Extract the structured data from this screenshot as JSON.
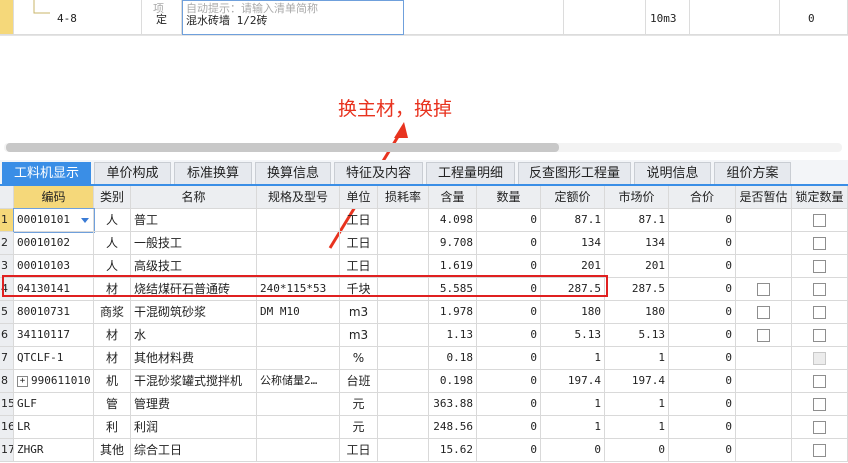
{
  "top": {
    "prev_row_hint": "自动提示：请输入清单简称",
    "prev_row_col2": "项",
    "row_code": "4-8",
    "row_type": "定",
    "row_name": "混水砖墙 1/2砖",
    "row_unit": "10m3",
    "row_value": "0"
  },
  "annotation": "换主材，换掉",
  "tabs": [
    "工料机显示",
    "单价构成",
    "标准换算",
    "换算信息",
    "特征及内容",
    "工程量明细",
    "反查图形工程量",
    "说明信息",
    "组价方案"
  ],
  "columns": [
    "编码",
    "类别",
    "名称",
    "规格及型号",
    "单位",
    "损耗率",
    "含量",
    "数量",
    "定额价",
    "市场价",
    "合价",
    "是否暂估",
    "锁定数量"
  ],
  "rows": [
    {
      "num": "1",
      "code": "00010101",
      "type": "人",
      "name": "普工",
      "spec": "",
      "unit": "工日",
      "loss": "",
      "qty": "4.098",
      "count": "0",
      "quota": "87.1",
      "market": "87.1",
      "total": "0",
      "est": "",
      "lock": "box"
    },
    {
      "num": "2",
      "code": "00010102",
      "type": "人",
      "name": "一般技工",
      "spec": "",
      "unit": "工日",
      "loss": "",
      "qty": "9.708",
      "count": "0",
      "quota": "134",
      "market": "134",
      "total": "0",
      "est": "",
      "lock": "box"
    },
    {
      "num": "3",
      "code": "00010103",
      "type": "人",
      "name": "高级技工",
      "spec": "",
      "unit": "工日",
      "loss": "",
      "qty": "1.619",
      "count": "0",
      "quota": "201",
      "market": "201",
      "total": "0",
      "est": "",
      "lock": "box"
    },
    {
      "num": "4",
      "code": "04130141",
      "type": "材",
      "name": "烧结煤矸石普通砖",
      "spec": "240*115*53",
      "unit": "千块",
      "loss": "",
      "qty": "5.585",
      "count": "0",
      "quota": "287.5",
      "market": "287.5",
      "total": "0",
      "est": "box",
      "lock": "box"
    },
    {
      "num": "5",
      "code": "80010731",
      "type": "商浆",
      "name": "干混砌筑砂浆",
      "spec": "DM M10",
      "unit": "m3",
      "loss": "",
      "qty": "1.978",
      "count": "0",
      "quota": "180",
      "market": "180",
      "total": "0",
      "est": "box",
      "lock": "box"
    },
    {
      "num": "6",
      "code": "34110117",
      "type": "材",
      "name": "水",
      "spec": "",
      "unit": "m3",
      "loss": "",
      "qty": "1.13",
      "count": "0",
      "quota": "5.13",
      "market": "5.13",
      "total": "0",
      "est": "box",
      "lock": "box"
    },
    {
      "num": "7",
      "code": "QTCLF-1",
      "type": "材",
      "name": "其他材料费",
      "spec": "",
      "unit": "%",
      "loss": "",
      "qty": "0.18",
      "count": "0",
      "quota": "1",
      "market": "1",
      "total": "0",
      "est": "",
      "lock": "dis"
    },
    {
      "num": "8",
      "code": "990611010",
      "type": "机",
      "name": "干混砂浆罐式搅拌机",
      "spec": "公称储量2…",
      "unit": "台班",
      "loss": "",
      "qty": "0.198",
      "count": "0",
      "quota": "197.4",
      "market": "197.4",
      "total": "0",
      "est": "",
      "lock": "box"
    },
    {
      "num": "15",
      "code": "GLF",
      "type": "管",
      "name": "管理费",
      "spec": "",
      "unit": "元",
      "loss": "",
      "qty": "363.88",
      "count": "0",
      "quota": "1",
      "market": "1",
      "total": "0",
      "est": "",
      "lock": "box"
    },
    {
      "num": "16",
      "code": "LR",
      "type": "利",
      "name": "利润",
      "spec": "",
      "unit": "元",
      "loss": "",
      "qty": "248.56",
      "count": "0",
      "quota": "1",
      "market": "1",
      "total": "0",
      "est": "",
      "lock": "box"
    },
    {
      "num": "17",
      "code": "ZHGR",
      "type": "其他",
      "name": "综合工日",
      "spec": "",
      "unit": "工日",
      "loss": "",
      "qty": "15.62",
      "count": "0",
      "quota": "0",
      "market": "0",
      "total": "0",
      "est": "",
      "lock": "box"
    }
  ],
  "colors": {
    "accent": "#3a8ee6",
    "highlight_header": "#f5d87a",
    "annotation": "#e8331f"
  },
  "icons": {
    "dropdown": "chevron-down-icon",
    "expand": "plus-icon"
  }
}
